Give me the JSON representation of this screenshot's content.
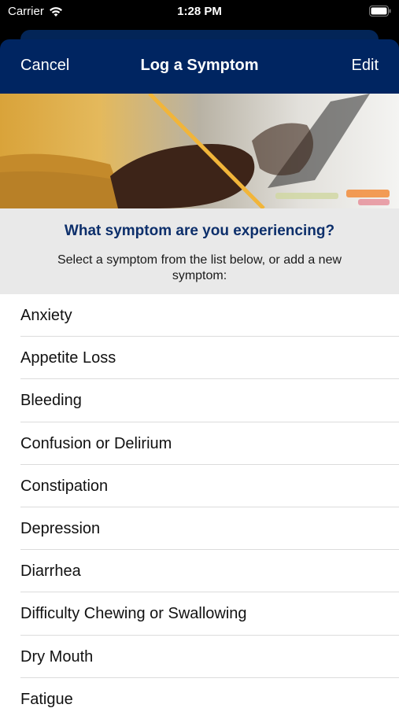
{
  "status_bar": {
    "carrier": "Carrier",
    "time": "1:28 PM"
  },
  "nav": {
    "cancel_label": "Cancel",
    "title": "Log a Symptom",
    "edit_label": "Edit"
  },
  "prompt": {
    "question": "What symptom are you experiencing?",
    "instructions": "Select a symptom from the list below, or add a new symptom:"
  },
  "symptoms": [
    "Anxiety",
    "Appetite Loss",
    "Bleeding",
    "Confusion or Delirium",
    "Constipation",
    "Depression",
    "Diarrhea",
    "Difficulty Chewing or Swallowing",
    "Dry Mouth",
    "Fatigue"
  ],
  "colors": {
    "nav_bg": "#002561",
    "question_text": "#0d2f6b",
    "prompt_bg": "#e9e9e9"
  }
}
